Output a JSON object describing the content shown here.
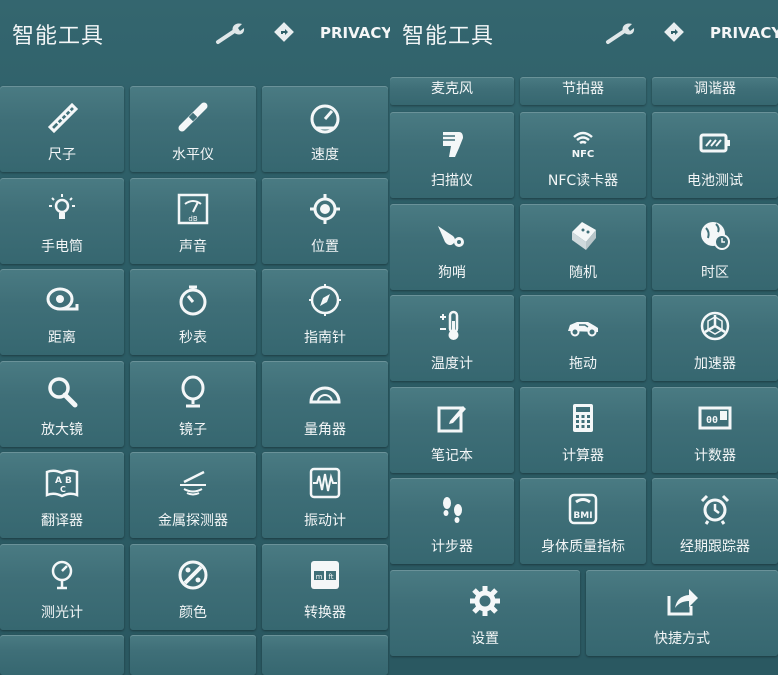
{
  "left": {
    "title": "智能工具",
    "privacy": "PRIVACY",
    "tiles": [
      {
        "label": "尺子",
        "icon": "ruler-icon"
      },
      {
        "label": "水平仪",
        "icon": "level-icon"
      },
      {
        "label": "速度",
        "icon": "speedometer-icon"
      },
      {
        "label": "手电筒",
        "icon": "flashlight-bulb-icon"
      },
      {
        "label": "声音",
        "icon": "sound-meter-icon"
      },
      {
        "label": "位置",
        "icon": "location-target-icon"
      },
      {
        "label": "距离",
        "icon": "tape-measure-icon"
      },
      {
        "label": "秒表",
        "icon": "stopwatch-icon"
      },
      {
        "label": "指南针",
        "icon": "compass-icon"
      },
      {
        "label": "放大镜",
        "icon": "magnifier-icon"
      },
      {
        "label": "镜子",
        "icon": "mirror-icon"
      },
      {
        "label": "量角器",
        "icon": "protractor-icon"
      },
      {
        "label": "翻译器",
        "icon": "translator-book-icon"
      },
      {
        "label": "金属探测器",
        "icon": "metal-detector-icon"
      },
      {
        "label": "振动计",
        "icon": "vibration-meter-icon"
      },
      {
        "label": "测光计",
        "icon": "light-meter-icon"
      },
      {
        "label": "颜色",
        "icon": "color-palette-icon"
      },
      {
        "label": "转换器",
        "icon": "unit-converter-icon"
      }
    ]
  },
  "right": {
    "title": "智能工具",
    "privacy": "PRIVACY",
    "partial_row": [
      "麦克风",
      "节拍器",
      "调谐器"
    ],
    "tiles": [
      {
        "label": "扫描仪",
        "icon": "barcode-scanner-icon"
      },
      {
        "label": "NFC读卡器",
        "icon": "nfc-icon",
        "icon_text": "NFC"
      },
      {
        "label": "电池测试",
        "icon": "battery-icon"
      },
      {
        "label": "狗哨",
        "icon": "dog-whistle-icon"
      },
      {
        "label": "随机",
        "icon": "dice-icon"
      },
      {
        "label": "时区",
        "icon": "globe-clock-icon"
      },
      {
        "label": "温度计",
        "icon": "thermometer-icon"
      },
      {
        "label": "拖动",
        "icon": "car-icon"
      },
      {
        "label": "加速器",
        "icon": "accelerometer-icon"
      },
      {
        "label": "笔记本",
        "icon": "notepad-icon"
      },
      {
        "label": "计算器",
        "icon": "calculator-icon"
      },
      {
        "label": "计数器",
        "icon": "counter-icon",
        "icon_text": "00"
      },
      {
        "label": "计步器",
        "icon": "footsteps-icon"
      },
      {
        "label": "身体质量指标",
        "icon": "bmi-scale-icon",
        "icon_text": "BMI"
      },
      {
        "label": "经期跟踪器",
        "icon": "alarm-clock-icon"
      }
    ],
    "bottom": [
      {
        "label": "设置",
        "icon": "gear-icon"
      },
      {
        "label": "快捷方式",
        "icon": "share-icon"
      }
    ]
  }
}
